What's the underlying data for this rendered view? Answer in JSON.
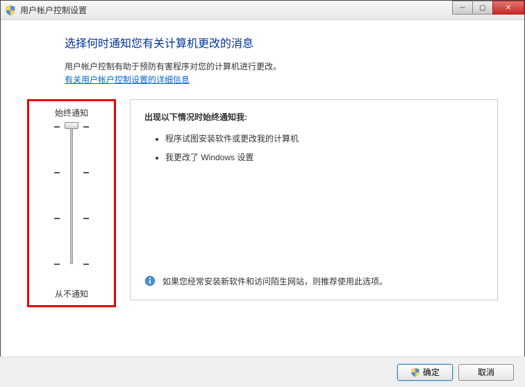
{
  "window": {
    "title": "用户帐户控制设置"
  },
  "page": {
    "heading": "选择何时通知您有关计算机更改的消息",
    "description": "用户帐户控制有助于预防有害程序对您的计算机进行更改。",
    "link": "有关用户帐户控制设置的详细信息"
  },
  "slider": {
    "top_label": "始终通知",
    "bottom_label": "从不通知"
  },
  "panel": {
    "heading": "出现以下情况时始终通知我:",
    "items": [
      "程序试图安装软件或更改我的计算机",
      "我更改了 Windows 设置"
    ],
    "recommendation": "如果您经常安装新软件和访问陌生网站，则推荐使用此选项。"
  },
  "buttons": {
    "ok": "确定",
    "cancel": "取消"
  }
}
